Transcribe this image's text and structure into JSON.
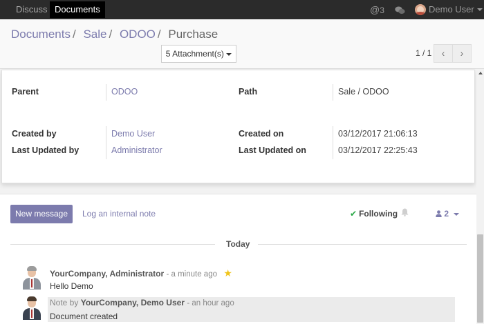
{
  "navbar": {
    "menus": [
      {
        "label": "Discuss"
      },
      {
        "label": "Documents",
        "active": true
      }
    ],
    "mentions_count": "3",
    "user_name": "Demo User",
    "icons": [
      "at-sign-icon",
      "chat-bubbles-icon",
      "user-avatar"
    ]
  },
  "breadcrumb": {
    "items": [
      "Documents",
      "Sale",
      "ODOO",
      "Purchase"
    ]
  },
  "toolbar": {
    "attachments_label": "5 Attachment(s)",
    "pager_value": "1 / 1"
  },
  "form": {
    "parent_label": "Parent",
    "parent_value": "ODOO",
    "path_label": "Path",
    "path_value": "Sale / ODOO",
    "created_by_label": "Created by",
    "created_by_value": "Demo User",
    "created_on_label": "Created on",
    "created_on_value": "03/12/2017 21:06:13",
    "updated_by_label": "Last Updated by",
    "updated_by_value": "Administrator",
    "updated_on_label": "Last Updated on",
    "updated_on_value": "03/12/2017 22:25:43"
  },
  "chatter": {
    "new_message_label": "New message",
    "log_note_label": "Log an internal note",
    "following_label": "Following",
    "followers_count": "2",
    "today_label": "Today",
    "messages": [
      {
        "author": "YourCompany, Administrator",
        "time": "- a minute ago",
        "body": "Hello Demo",
        "starred": true
      },
      {
        "prefix": "Note by",
        "author": "YourCompany, Demo User",
        "time": "- an hour ago",
        "body": "Document created"
      }
    ]
  },
  "colors": {
    "navbar_bg": "#2b2b2b",
    "accent": "#7c7bad",
    "following_check": "#28a745",
    "star": "#f0c419"
  }
}
